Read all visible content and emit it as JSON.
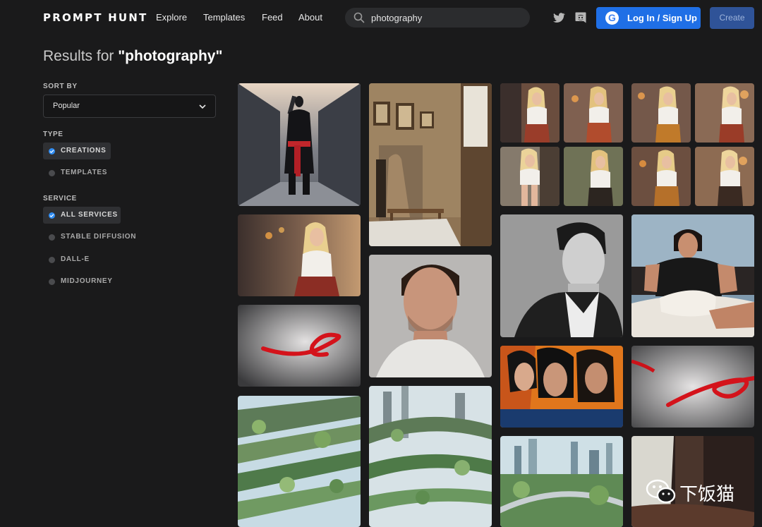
{
  "nav": {
    "logo": "PROMPT HUNT",
    "links": [
      "Explore",
      "Templates",
      "Feed",
      "About"
    ],
    "search": {
      "value": "photography",
      "icon": "search-icon"
    },
    "social": [
      "twitter-icon",
      "discord-icon"
    ],
    "login_label": "Log In / Sign Up",
    "create_label": "Create"
  },
  "results": {
    "prefix": "Results for ",
    "query": "\"photography\""
  },
  "sidebar": {
    "sort_heading": "SORT BY",
    "sort_value": "Popular",
    "type_heading": "TYPE",
    "type_options": [
      {
        "label": "CREATIONS",
        "selected": true
      },
      {
        "label": "TEMPLATES",
        "selected": false
      }
    ],
    "service_heading": "SERVICE",
    "service_options": [
      {
        "label": "ALL SERVICES",
        "selected": true
      },
      {
        "label": "STABLE DIFFUSION",
        "selected": false
      },
      {
        "label": "DALL-E",
        "selected": false
      },
      {
        "label": "MIDJOURNEY",
        "selected": false
      }
    ]
  },
  "gallery": [
    {
      "name": "samurai-street"
    },
    {
      "name": "blonde-woman-street"
    },
    {
      "name": "red-ribbon"
    },
    {
      "name": "overgrown-city-bridges"
    },
    {
      "name": "vintage-room-couple"
    },
    {
      "name": "man-portrait-smile"
    },
    {
      "name": "futuristic-green-city"
    },
    {
      "name": "blonde-woman-grid-1"
    },
    {
      "name": "blonde-woman-grid-2"
    },
    {
      "name": "black-white-man-portrait"
    },
    {
      "name": "three-women-illustration"
    },
    {
      "name": "green-city-skyline"
    },
    {
      "name": "man-in-bed"
    },
    {
      "name": "red-ribbon-2"
    },
    {
      "name": "dark-doorway"
    }
  ],
  "watermark": {
    "text": "下饭猫",
    "icon": "wechat-icon"
  },
  "colors": {
    "accent": "#1f6fe6",
    "create": "#2f5398",
    "selected_dot": "#2f8cf2",
    "background": "#1a1a1b"
  }
}
